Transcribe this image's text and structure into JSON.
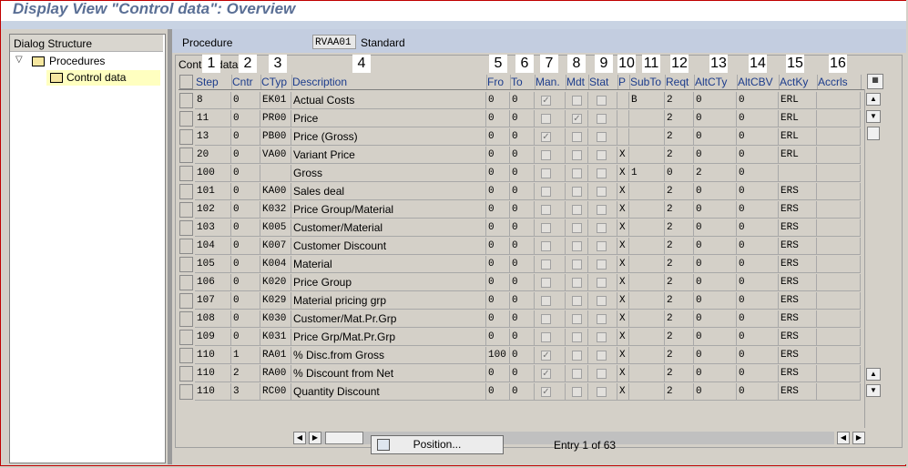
{
  "window": {
    "title": "Display View \"Control data\": Overview"
  },
  "tree": {
    "header": "Dialog Structure",
    "items": [
      {
        "label": "Procedures",
        "icon": "folder-icon",
        "expanded": true
      },
      {
        "label": "Control data",
        "icon": "open-folder-icon",
        "selected": true
      }
    ]
  },
  "procedure": {
    "label": "Procedure",
    "value": "RVAA01",
    "description": "Standard"
  },
  "table": {
    "title": "Control data",
    "column_headers": [
      "Step",
      "Cntr",
      "CTyp",
      "Description",
      "Fro",
      "To",
      "Man.",
      "Mdt",
      "Stat",
      "P",
      "SubTo",
      "Reqt",
      "AltCTy",
      "AltCBV",
      "ActKy",
      "Accrls"
    ],
    "column_numbers": [
      "1",
      "2",
      "3",
      "4",
      "5",
      "6",
      "7",
      "8",
      "9",
      "10",
      "11",
      "12",
      "13",
      "14",
      "15",
      "16"
    ],
    "rows": [
      {
        "step": "8",
        "cntr": "0",
        "ctyp": "EK01",
        "desc": "Actual Costs",
        "fro": "0",
        "to": "0",
        "man": true,
        "mdt": false,
        "stat": false,
        "p": "",
        "subto": "B",
        "reqt": "2",
        "altcty": "0",
        "altcbv": "0",
        "actky": "ERL",
        "accrls": ""
      },
      {
        "step": "11",
        "cntr": "0",
        "ctyp": "PR00",
        "desc": "Price",
        "fro": "0",
        "to": "0",
        "man": false,
        "mdt": true,
        "stat": false,
        "p": "",
        "subto": "",
        "reqt": "2",
        "altcty": "0",
        "altcbv": "0",
        "actky": "ERL",
        "accrls": ""
      },
      {
        "step": "13",
        "cntr": "0",
        "ctyp": "PB00",
        "desc": "Price (Gross)",
        "fro": "0",
        "to": "0",
        "man": true,
        "mdt": false,
        "stat": false,
        "p": "",
        "subto": "",
        "reqt": "2",
        "altcty": "0",
        "altcbv": "0",
        "actky": "ERL",
        "accrls": ""
      },
      {
        "step": "20",
        "cntr": "0",
        "ctyp": "VA00",
        "desc": "Variant Price",
        "fro": "0",
        "to": "0",
        "man": false,
        "mdt": false,
        "stat": false,
        "p": "X",
        "subto": "",
        "reqt": "2",
        "altcty": "0",
        "altcbv": "0",
        "actky": "ERL",
        "accrls": ""
      },
      {
        "step": "100",
        "cntr": "0",
        "ctyp": "",
        "desc": "Gross",
        "fro": "0",
        "to": "0",
        "man": false,
        "mdt": false,
        "stat": false,
        "p": "X",
        "subto": "1",
        "reqt": "0",
        "altcty": "2",
        "altcbv": "0",
        "actky": "",
        "accrls": ""
      },
      {
        "step": "101",
        "cntr": "0",
        "ctyp": "KA00",
        "desc": "Sales deal",
        "fro": "0",
        "to": "0",
        "man": false,
        "mdt": false,
        "stat": false,
        "p": "X",
        "subto": "",
        "reqt": "2",
        "altcty": "0",
        "altcbv": "0",
        "actky": "ERS",
        "accrls": ""
      },
      {
        "step": "102",
        "cntr": "0",
        "ctyp": "K032",
        "desc": "Price Group/Material",
        "fro": "0",
        "to": "0",
        "man": false,
        "mdt": false,
        "stat": false,
        "p": "X",
        "subto": "",
        "reqt": "2",
        "altcty": "0",
        "altcbv": "0",
        "actky": "ERS",
        "accrls": ""
      },
      {
        "step": "103",
        "cntr": "0",
        "ctyp": "K005",
        "desc": "Customer/Material",
        "fro": "0",
        "to": "0",
        "man": false,
        "mdt": false,
        "stat": false,
        "p": "X",
        "subto": "",
        "reqt": "2",
        "altcty": "0",
        "altcbv": "0",
        "actky": "ERS",
        "accrls": ""
      },
      {
        "step": "104",
        "cntr": "0",
        "ctyp": "K007",
        "desc": "Customer Discount",
        "fro": "0",
        "to": "0",
        "man": false,
        "mdt": false,
        "stat": false,
        "p": "X",
        "subto": "",
        "reqt": "2",
        "altcty": "0",
        "altcbv": "0",
        "actky": "ERS",
        "accrls": ""
      },
      {
        "step": "105",
        "cntr": "0",
        "ctyp": "K004",
        "desc": "Material",
        "fro": "0",
        "to": "0",
        "man": false,
        "mdt": false,
        "stat": false,
        "p": "X",
        "subto": "",
        "reqt": "2",
        "altcty": "0",
        "altcbv": "0",
        "actky": "ERS",
        "accrls": ""
      },
      {
        "step": "106",
        "cntr": "0",
        "ctyp": "K020",
        "desc": "Price Group",
        "fro": "0",
        "to": "0",
        "man": false,
        "mdt": false,
        "stat": false,
        "p": "X",
        "subto": "",
        "reqt": "2",
        "altcty": "0",
        "altcbv": "0",
        "actky": "ERS",
        "accrls": ""
      },
      {
        "step": "107",
        "cntr": "0",
        "ctyp": "K029",
        "desc": "Material pricing grp",
        "fro": "0",
        "to": "0",
        "man": false,
        "mdt": false,
        "stat": false,
        "p": "X",
        "subto": "",
        "reqt": "2",
        "altcty": "0",
        "altcbv": "0",
        "actky": "ERS",
        "accrls": ""
      },
      {
        "step": "108",
        "cntr": "0",
        "ctyp": "K030",
        "desc": "Customer/Mat.Pr.Grp",
        "fro": "0",
        "to": "0",
        "man": false,
        "mdt": false,
        "stat": false,
        "p": "X",
        "subto": "",
        "reqt": "2",
        "altcty": "0",
        "altcbv": "0",
        "actky": "ERS",
        "accrls": ""
      },
      {
        "step": "109",
        "cntr": "0",
        "ctyp": "K031",
        "desc": "Price Grp/Mat.Pr.Grp",
        "fro": "0",
        "to": "0",
        "man": false,
        "mdt": false,
        "stat": false,
        "p": "X",
        "subto": "",
        "reqt": "2",
        "altcty": "0",
        "altcbv": "0",
        "actky": "ERS",
        "accrls": ""
      },
      {
        "step": "110",
        "cntr": "1",
        "ctyp": "RA01",
        "desc": "% Disc.from Gross",
        "fro": "100",
        "to": "0",
        "man": true,
        "mdt": false,
        "stat": false,
        "p": "X",
        "subto": "",
        "reqt": "2",
        "altcty": "0",
        "altcbv": "0",
        "actky": "ERS",
        "accrls": ""
      },
      {
        "step": "110",
        "cntr": "2",
        "ctyp": "RA00",
        "desc": "% Discount from Net",
        "fro": "0",
        "to": "0",
        "man": true,
        "mdt": false,
        "stat": false,
        "p": "X",
        "subto": "",
        "reqt": "2",
        "altcty": "0",
        "altcbv": "0",
        "actky": "ERS",
        "accrls": ""
      },
      {
        "step": "110",
        "cntr": "3",
        "ctyp": "RC00",
        "desc": "Quantity Discount",
        "fro": "0",
        "to": "0",
        "man": true,
        "mdt": false,
        "stat": false,
        "p": "X",
        "subto": "",
        "reqt": "2",
        "altcty": "0",
        "altcbv": "0",
        "actky": "ERS",
        "accrls": ""
      }
    ]
  },
  "footer": {
    "position_button": "Position...",
    "entry_text": "Entry 1 of 63"
  },
  "colors": {
    "title_text": "#5a6f95",
    "column_header_text": "#1c3c8c",
    "proc_bar": "#c3cde0",
    "selected_tree_item": "#ffffc0"
  }
}
